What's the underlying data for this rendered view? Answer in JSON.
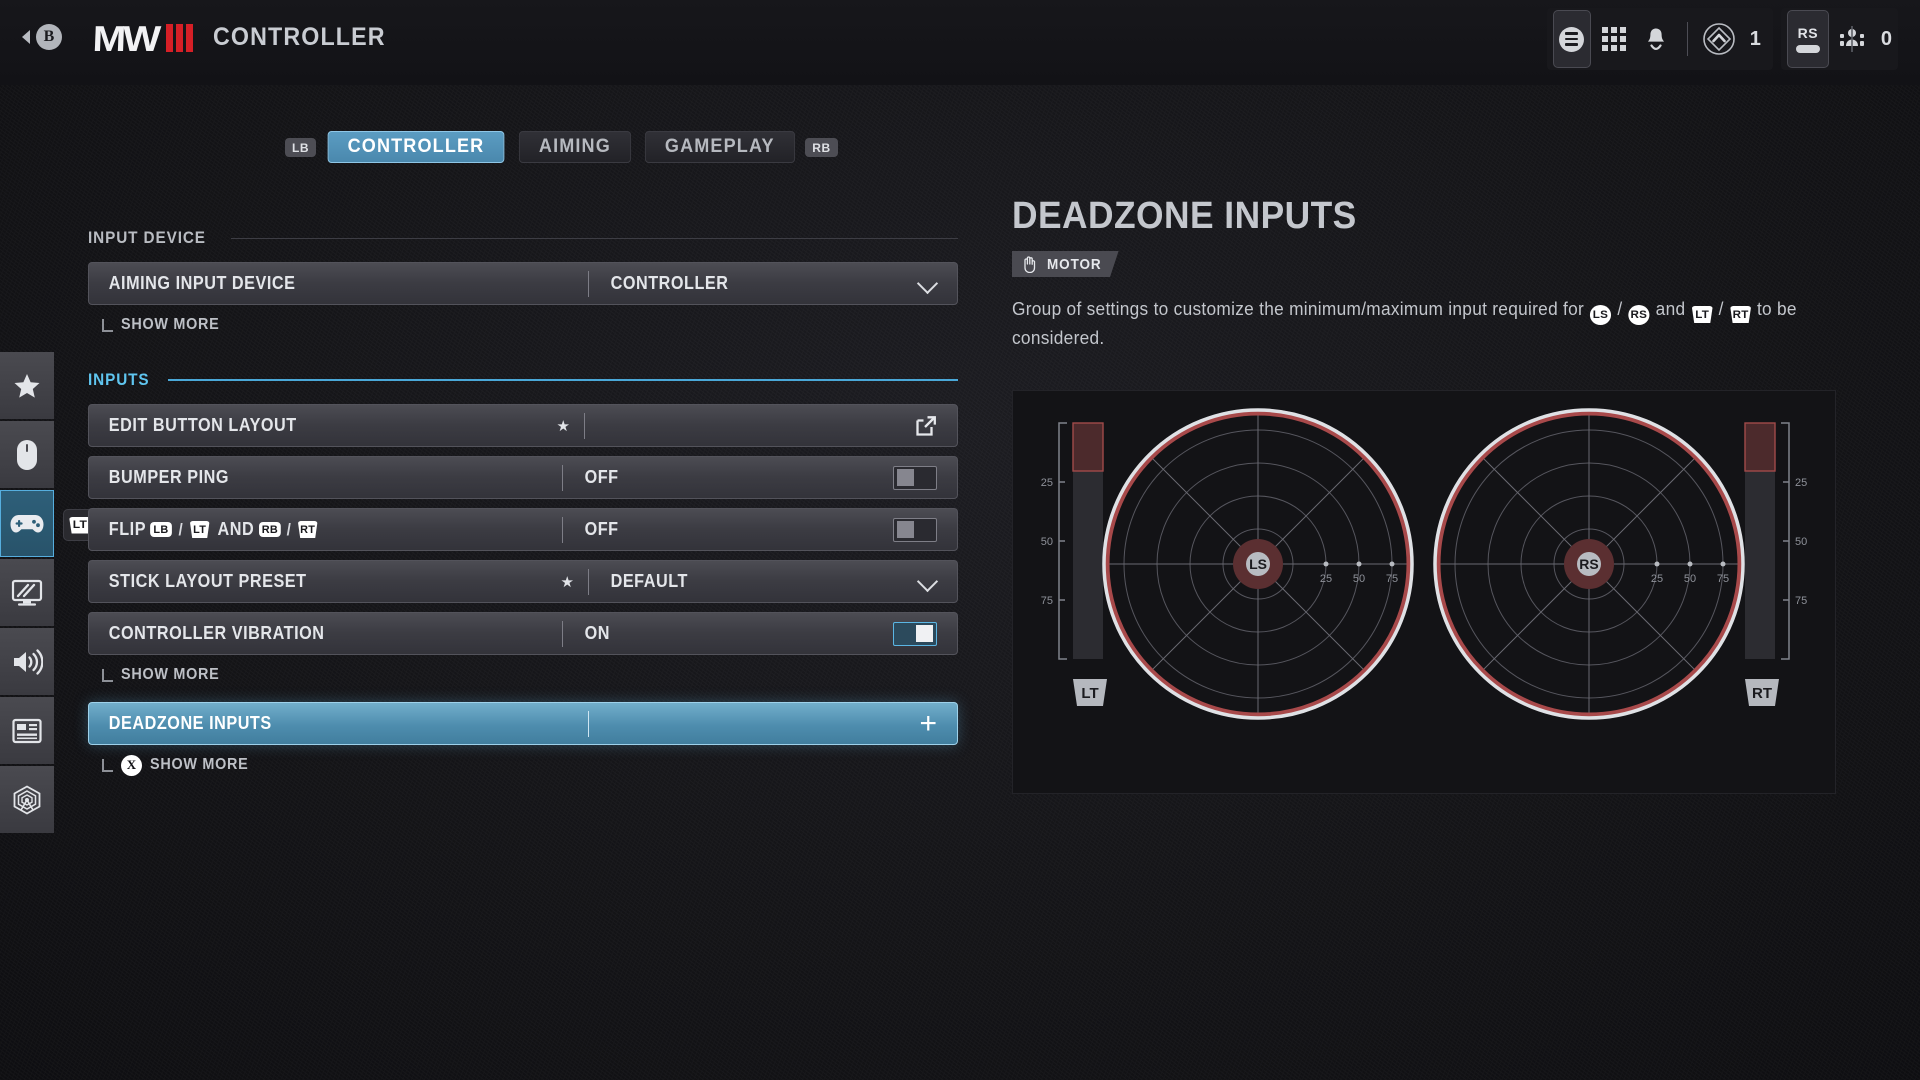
{
  "header": {
    "back_button": "B",
    "logo_text": "MW",
    "title": "CONTROLLER"
  },
  "top_right": {
    "menu_icon": "hamburger-circle-icon",
    "apps_icon": "grid-apps-icon",
    "notifications_icon": "bell-icon",
    "rank_icon": "rank-emblem-icon",
    "rank_value": "1",
    "stick_chip_label": "RS",
    "party_icon": "party-members-icon",
    "party_count": "0"
  },
  "sidebar": {
    "items": [
      {
        "name": "favorites",
        "icon": "star-icon"
      },
      {
        "name": "mouse-keyboard",
        "icon": "mouse-icon"
      },
      {
        "name": "controller",
        "icon": "gamepad-icon",
        "active": true,
        "badge": "LT"
      },
      {
        "name": "graphics",
        "icon": "monitor-icon"
      },
      {
        "name": "audio",
        "icon": "speaker-icon"
      },
      {
        "name": "interface",
        "icon": "hud-layout-icon"
      },
      {
        "name": "account-network",
        "icon": "network-emblem-icon"
      }
    ]
  },
  "tabs": {
    "left_bumper": "LB",
    "right_bumper": "RB",
    "items": [
      {
        "label": "CONTROLLER",
        "active": true
      },
      {
        "label": "AIMING",
        "active": false
      },
      {
        "label": "GAMEPLAY",
        "active": false
      }
    ]
  },
  "sections": [
    {
      "title": "INPUT DEVICE",
      "accent": false,
      "rows": [
        {
          "label": "AIMING INPUT DEVICE",
          "value": "CONTROLLER",
          "control": "dropdown",
          "star": false,
          "selected": false
        }
      ],
      "show_more": {
        "label": "SHOW MORE",
        "prompt": ""
      }
    },
    {
      "title": "INPUTS",
      "accent": true,
      "rows": [
        {
          "label": "EDIT BUTTON LAYOUT",
          "value": "",
          "control": "external-link",
          "star": true,
          "selected": false
        },
        {
          "label": "BUMPER PING",
          "value": "OFF",
          "control": "toggle-off",
          "star": false,
          "selected": false
        },
        {
          "label": "FLIP",
          "label_glyphs": [
            "LB",
            "/",
            "LT",
            "AND",
            "RB",
            "/",
            "RT"
          ],
          "value": "OFF",
          "control": "toggle-off",
          "star": false,
          "selected": false
        },
        {
          "label": "STICK LAYOUT PRESET",
          "value": "DEFAULT",
          "control": "dropdown",
          "star": true,
          "selected": false
        },
        {
          "label": "CONTROLLER VIBRATION",
          "value": "ON",
          "control": "toggle-on",
          "star": false,
          "selected": false
        }
      ],
      "show_more": {
        "label": "SHOW MORE",
        "prompt": ""
      }
    }
  ],
  "selected_row": {
    "label": "DEADZONE INPUTS",
    "value": "",
    "control": "plus",
    "show_more": {
      "label": "SHOW MORE",
      "prompt": "X"
    }
  },
  "detail": {
    "title": "DEADZONE INPUTS",
    "tag": {
      "label": "MOTOR",
      "icon": "hand-icon"
    },
    "description_part1": "Group of settings to customize the minimum/maximum input required for",
    "glyph_ls": "LS",
    "sep1": "/",
    "glyph_rs": "RS",
    "joiner": "and",
    "glyph_lt": "LT",
    "sep2": "/",
    "glyph_rt": "RT",
    "description_part2": "to be considered."
  },
  "visualization": {
    "left_trigger": {
      "label": "LT",
      "ticks": [
        "25",
        "50",
        "75"
      ],
      "fill_percent": 20
    },
    "right_trigger": {
      "label": "RT",
      "ticks": [
        "25",
        "50",
        "75"
      ],
      "fill_percent": 20
    },
    "left_stick": {
      "label": "LS",
      "ticks": [
        "25",
        "50",
        "75"
      ],
      "deadzone_percent": 12,
      "max_ring_percent": 100
    },
    "right_stick": {
      "label": "RS",
      "ticks": [
        "25",
        "50",
        "75"
      ],
      "deadzone_percent": 12,
      "max_ring_percent": 100
    }
  },
  "colors": {
    "accent_blue": "#5fc5ef",
    "selected_row_blue": "#4e8dae",
    "logo_red": "#d61f26",
    "ring_red": "#a83c3c",
    "ring_white": "#dcdee2",
    "background": "#141417",
    "panel": "#131316"
  }
}
